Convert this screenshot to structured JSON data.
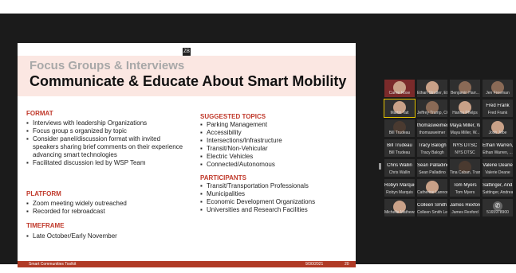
{
  "slide": {
    "logo_text": "ZB",
    "subtitle": "Focus Groups & Interviews",
    "title": "Communicate & Educate About Smart Mobility",
    "format_heading": "FORMAT",
    "format_items": [
      "Interviews with leadership Organizations",
      "Focus group s organized by topic",
      "Consider panel/discussion format with invited speakers sharing brief comments on their experience advancing smart technologies",
      "Facilitated discussion led by WSP Team"
    ],
    "platform_heading": "PLATFORM",
    "platform_items": [
      "Zoom meeting widely outreached",
      "Recorded for rebroadcast"
    ],
    "timeframe_heading": "TIMEFRAME",
    "timeframe_items": [
      "Late October/Early November"
    ],
    "topics_heading": "SUGGESTED TOPICS",
    "topics_items": [
      "Parking Management",
      "Accessibility",
      "Intersections/Infrastructure",
      "Transit/Non-Vehicular",
      "Electric Vehicles",
      "Connected/Autonomous"
    ],
    "participants_heading": "PARTICIPANTS",
    "participants_items": [
      "Transit/Transportation Professionals",
      "Municipalities",
      "Economic Development Organizations",
      "Universities and Research Facilities"
    ],
    "footer_left": "Smart Communities Toolkit",
    "footer_date": "9/30/2021",
    "footer_page": "20"
  },
  "gallery": {
    "tiles": [
      {
        "caption": "Carrie Rose"
      },
      {
        "caption": "Ethan Strutter, Ethan Br..."
      },
      {
        "caption": "Benjamin Harr..."
      },
      {
        "caption": "Jen Freeman"
      },
      {
        "caption": "Martin Tait"
      },
      {
        "caption": "Jeffrey Trump, CGTC"
      },
      {
        "caption": "Hanna Phelps"
      },
      {
        "caption": "Fred Frank"
      },
      {
        "caption": "Bill Trudeau"
      },
      {
        "caption": "thomasweimer"
      },
      {
        "caption": "Maya Miller, W..."
      },
      {
        "caption": "Josh Jobe"
      },
      {
        "caption": "Bill Trudeau"
      },
      {
        "caption": "Tracy Balogh"
      },
      {
        "caption": "NYS DTSC"
      },
      {
        "caption": "Ethan Warren, ..."
      },
      {
        "caption": "Chris Wallin"
      },
      {
        "caption": "Sean Palladino"
      },
      {
        "caption": "Tina Caban, Transp..."
      },
      {
        "caption": "Valerie Deane"
      },
      {
        "caption": "Robyn Marquis"
      },
      {
        "caption": "Catherine Lannon"
      },
      {
        "caption": "Tom Myers"
      },
      {
        "caption": "Sattinger, Andrea..."
      },
      {
        "caption": "Michelle Mathews"
      },
      {
        "caption": "Colleen Smith Lennon"
      },
      {
        "caption": "James Rexford"
      },
      {
        "caption": "5165978900"
      }
    ],
    "big_names": [
      "Fred Frank",
      "thomasweimer",
      "Maya Miller, W...",
      "Bill Trudeau",
      "Tracy Balogh",
      "NYS DTSC",
      "Ethan Warren, ...",
      "Chris Wallin",
      "Sean Palladino",
      "Valerie Deane",
      "Robyn Marquis",
      "Tom Myers",
      "Sattinger, And...",
      "Colleen Smith...",
      "James Rexford"
    ]
  }
}
